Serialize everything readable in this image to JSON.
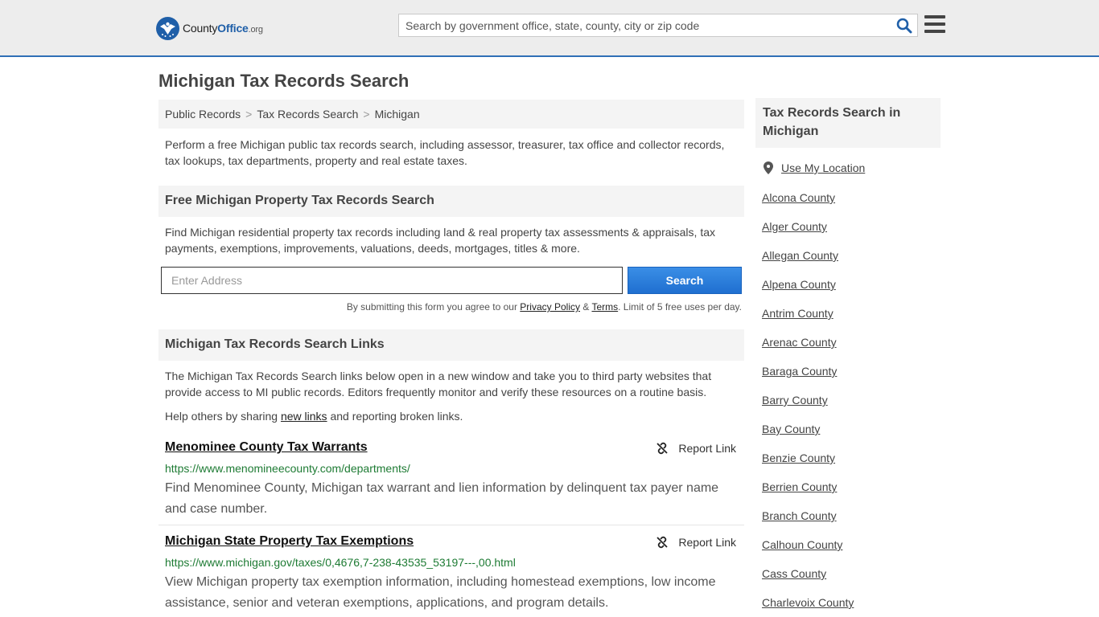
{
  "header": {
    "logo": {
      "brand_prefix": "County",
      "brand_main": "Office",
      "brand_suffix": ".org"
    },
    "search_placeholder": "Search by government office, state, county, city or zip code",
    "icons": {
      "search": "search-icon",
      "menu": "hamburger-menu-icon"
    },
    "accent_color": "#2f6fb6"
  },
  "page": {
    "title": "Michigan Tax Records Search",
    "breadcrumb": [
      "Public Records",
      "Tax Records Search",
      "Michigan"
    ],
    "breadcrumb_separator": ">",
    "intro": "Perform a free Michigan public tax records search, including assessor, treasurer, tax office and collector records, tax lookups, tax departments, property and real estate taxes."
  },
  "property_search": {
    "heading": "Free Michigan Property Tax Records Search",
    "description": "Find Michigan residential property tax records including land & real property tax assessments & appraisals, tax payments, exemptions, improvements, valuations, deeds, mortgages, titles & more.",
    "input_placeholder": "Enter Address",
    "button_label": "Search",
    "disclaimer_prefix": "By submitting this form you agree to our",
    "privacy_label": "Privacy Policy",
    "amp": "&",
    "terms_label": "Terms",
    "disclaimer_suffix": ". Limit of 5 free uses per day."
  },
  "links_section": {
    "heading": "Michigan Tax Records Search Links",
    "description": "The Michigan Tax Records Search links below open in a new window and take you to third party websites that provide access to MI public records. Editors frequently monitor and verify these resources on a routine basis.",
    "help_prefix": "Help others by sharing",
    "help_link": "new links",
    "help_suffix": "and reporting broken links.",
    "report_label": "Report Link",
    "items": [
      {
        "title": "Menominee County Tax Warrants",
        "url": "https://www.menomineecounty.com/departments/",
        "description": "Find Menominee County, Michigan tax warrant and lien information by delinquent tax payer name and case number."
      },
      {
        "title": "Michigan State Property Tax Exemptions",
        "url": "https://www.michigan.gov/taxes/0,4676,7-238-43535_53197---,00.html",
        "description": "View Michigan property tax exemption information, including homestead exemptions, low income assistance, senior and veteran exemptions, applications, and program details."
      }
    ]
  },
  "sidebar": {
    "heading": "Tax Records Search in Michigan",
    "use_location": "Use My Location",
    "counties": [
      "Alcona County",
      "Alger County",
      "Allegan County",
      "Alpena County",
      "Antrim County",
      "Arenac County",
      "Baraga County",
      "Barry County",
      "Bay County",
      "Benzie County",
      "Berrien County",
      "Branch County",
      "Calhoun County",
      "Cass County",
      "Charlevoix County"
    ]
  }
}
